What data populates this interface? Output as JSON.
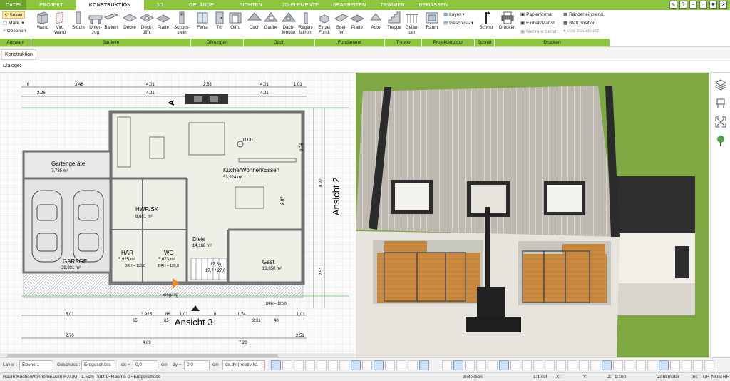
{
  "tabs": [
    "DATEI",
    "PROJEKT",
    "KONSTRUKTION",
    "3D",
    "GELÄNDE",
    "SICHTEN",
    "2D-ELEMENTE",
    "BEARBEITEN",
    "TRIMMEN",
    "BEMASSEN"
  ],
  "auswahl": {
    "select": "Selekt",
    "mark": "Mark.",
    "options": "Optionen"
  },
  "ribbon_buttons": [
    {
      "id": "wand",
      "label": "Wand"
    },
    {
      "id": "virt-wand",
      "label": "Virt. Wand"
    },
    {
      "id": "stuetze",
      "label": "Stütze"
    },
    {
      "id": "unterzug",
      "label": "Unter- zug"
    },
    {
      "id": "balken",
      "label": "Balken"
    },
    {
      "id": "decke",
      "label": "Decke"
    },
    {
      "id": "deckoeffn",
      "label": "Deck- öffn."
    },
    {
      "id": "platte",
      "label": "Platte"
    },
    {
      "id": "schornstein",
      "label": "Schorn- stein"
    },
    {
      "id": "fenst",
      "label": "Fenst"
    },
    {
      "id": "tuer",
      "label": "Tür"
    },
    {
      "id": "oeffn",
      "label": "Öffn."
    },
    {
      "id": "dach",
      "label": "Dach"
    },
    {
      "id": "gaube",
      "label": "Gaube"
    },
    {
      "id": "dachfenster",
      "label": "Dach- fenster"
    },
    {
      "id": "regenfallrohr",
      "label": "Regen- fallrohr"
    },
    {
      "id": "einzelfund",
      "label": "Einzel Fund."
    },
    {
      "id": "streifen",
      "label": "Strei- fen"
    },
    {
      "id": "platte2",
      "label": "Platte"
    },
    {
      "id": "auto",
      "label": "Auto"
    },
    {
      "id": "treppe",
      "label": "Treppe"
    },
    {
      "id": "gelaender",
      "label": "Gelän- der"
    },
    {
      "id": "raum",
      "label": "Raum"
    },
    {
      "id": "schnitt",
      "label": "Schnitt"
    },
    {
      "id": "drucken",
      "label": "Drucken"
    }
  ],
  "projekt_cmds": {
    "layer": "Layer",
    "geschoss": "Geschoss"
  },
  "druck_cmds": [
    "Papierformat",
    "Einheit/Maßst.",
    "Mehrere Seiten",
    "Ränder einblend.",
    "Blatt position.",
    "Pos zurücksetz."
  ],
  "group_labels": [
    "Auswahl",
    "Bauteile",
    "Öffnungen",
    "Dach",
    "Fundament",
    "Treppe",
    "Projektstruktur",
    "Schnitt",
    "Drucken"
  ],
  "subtab": "Konstruktion",
  "dialog_label": "Dialoge:",
  "plan": {
    "rooms": [
      {
        "name": "Gartengeräte",
        "area": "7,735 m²"
      },
      {
        "name": "Küche/Wohnen/Essen",
        "area": "53,924 m²"
      },
      {
        "name": "HWR/SK",
        "area": "8,681 m²"
      },
      {
        "name": "Diele",
        "area": "14,168 m²"
      },
      {
        "name": "HAR",
        "area": "3,925 m²"
      },
      {
        "name": "WC",
        "area": "3,673 m²"
      },
      {
        "name": "GARAGE",
        "area": "29,931 m²"
      },
      {
        "name": "Gast",
        "area": "13,850 m²"
      }
    ],
    "stairs": "17 Stg.",
    "stairs_dims": "17,7 / 27,0",
    "level": "0.00",
    "entrance": "Eingang",
    "view_a": "A",
    "view3": "Ansicht 3",
    "view2": "Ansicht 2",
    "top_dims_row1": [
      "6",
      "3.46",
      "4.01",
      "2.63",
      "4.01",
      "1.01",
      "2.26"
    ],
    "top_dims_row2": [
      "2.26",
      "4.01",
      "4.01"
    ],
    "bottom_dims_row1": [
      "5.01",
      "3.925",
      "86",
      "1.01",
      "8",
      "1.74",
      "1.01"
    ],
    "bottom_dims_row2": [
      "2.70",
      "4.09",
      "7.20",
      "2.51"
    ],
    "bottom_dims_small": [
      "65",
      "65",
      "2.31",
      "40"
    ],
    "right_dims": [
      "3.76",
      "2.87",
      "8.27",
      "2.51"
    ],
    "brh_labels": [
      "BRH = 135,0",
      "BRH = 135,0",
      "BRH = 126,0",
      "BRH = 126,0"
    ]
  },
  "right_tools": [
    "layers-icon",
    "chair-icon",
    "expand-icon",
    "tree-icon"
  ],
  "bottom_toolbar": {
    "layer_label": "Layer :",
    "layer_value": "Ebene 1",
    "geschoss_label": "Geschoss :",
    "geschoss_value": "Erdgeschoss",
    "dx_label": "dx =",
    "dx_value": "0,0",
    "dy_label": "dy =",
    "dy_value": "0,0",
    "unit": "cm",
    "mode": "dx,dy (relativ ka"
  },
  "status": {
    "hint": "Raum Küche/Wohnen/Essen RAUM - 1.5cm Putz L=Räume G=Erdgeschoss",
    "mode": "Selektion",
    "scale_sel": "1:1 sel",
    "x": "X:",
    "y": "Y:",
    "z": "Z:",
    "scale": "1:100",
    "unit": "Zentimeter",
    "ins": "Ins",
    "uf": "UF",
    "num": "NUM",
    "rf": "RF"
  },
  "colors": {
    "accent": "#8cc63f",
    "grass": "#7ea842",
    "roof": "#b9b5ad"
  }
}
